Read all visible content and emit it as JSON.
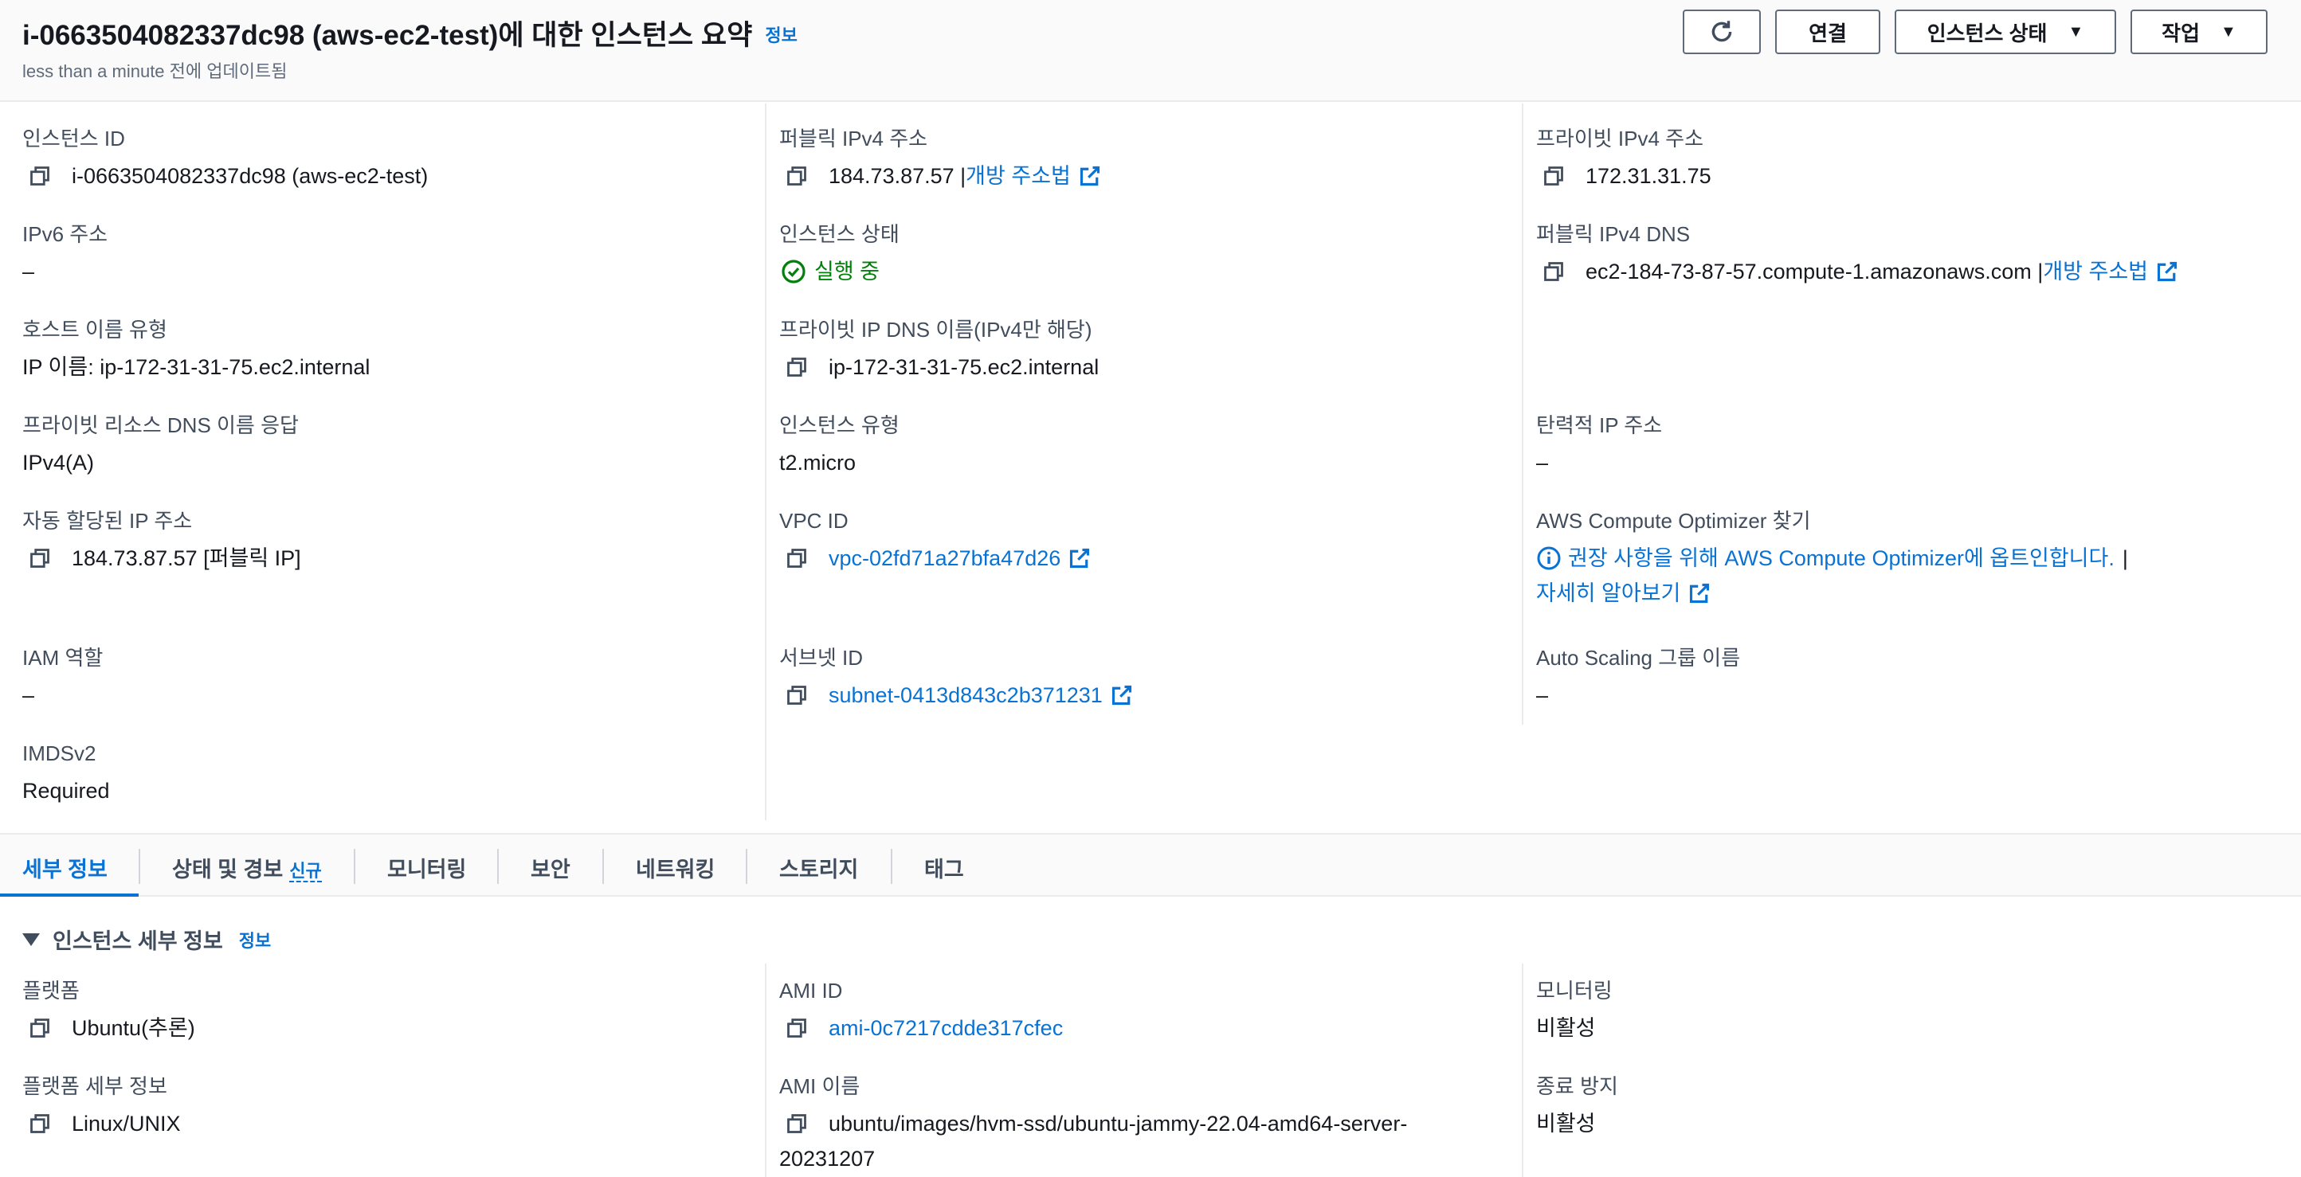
{
  "header": {
    "title": "i-0663504082337dc98 (aws-ec2-test)에 대한 인스턴스 요약",
    "info": "정보",
    "subtitle": "less than a minute 전에 업데이트됨",
    "buttons": {
      "connect": "연결",
      "instance_state": "인스턴스 상태",
      "actions": "작업"
    }
  },
  "summary": {
    "col1": [
      {
        "label": "인스턴스 ID",
        "value": "i-0663504082337dc98 (aws-ec2-test)"
      },
      {
        "label": "IPv6 주소",
        "value": "–"
      },
      {
        "label": "호스트 이름 유형",
        "value": "IP 이름: ip-172-31-31-75.ec2.internal"
      },
      {
        "label": "프라이빗 리소스 DNS 이름 응답",
        "value": "IPv4(A)"
      },
      {
        "label": "자동 할당된 IP 주소",
        "value": "184.73.87.57 [퍼블릭 IP]"
      },
      {
        "label": "IAM 역할",
        "value": "–"
      },
      {
        "label": "IMDSv2",
        "value": "Required"
      }
    ],
    "col2": [
      {
        "label": "퍼블릭 IPv4 주소",
        "value": "184.73.87.57 |",
        "link": "개방 주소법"
      },
      {
        "label": "인스턴스 상태",
        "value": "실행 중"
      },
      {
        "label": "프라이빗 IP DNS 이름(IPv4만 해당)",
        "value": "ip-172-31-31-75.ec2.internal"
      },
      {
        "label": "인스턴스 유형",
        "value": "t2.micro"
      },
      {
        "label": "VPC ID",
        "value": "vpc-02fd71a27bfa47d26"
      },
      {
        "label": "서브넷 ID",
        "value": "subnet-0413d843c2b371231"
      }
    ],
    "col3": [
      {
        "label": "프라이빗 IPv4 주소",
        "value": "172.31.31.75"
      },
      {
        "label": "퍼블릭 IPv4 DNS",
        "value": "ec2-184-73-87-57.compute-1.amazonaws.com |",
        "link": "개방 주소법"
      },
      {
        "label": "탄력적 IP 주소",
        "value": "–"
      },
      {
        "label": "AWS Compute Optimizer 찾기",
        "value": "권장 사항을 위해 AWS Compute Optimizer에 옵트인합니다.",
        "sep": "|",
        "link": "자세히 알아보기"
      },
      {
        "label": "Auto Scaling 그룹 이름",
        "value": "–"
      }
    ]
  },
  "tabs": [
    {
      "label": "세부 정보",
      "active": true
    },
    {
      "label": "상태 및 경보",
      "badge": "신규"
    },
    {
      "label": "모니터링"
    },
    {
      "label": "보안"
    },
    {
      "label": "네트워킹"
    },
    {
      "label": "스토리지"
    },
    {
      "label": "태그"
    }
  ],
  "details": {
    "section_title": "인스턴스 세부 정보",
    "info": "정보",
    "col1": [
      {
        "label": "플랫폼",
        "value": "Ubuntu(추론)"
      },
      {
        "label": "플랫폼 세부 정보",
        "value": "Linux/UNIX"
      }
    ],
    "col2": [
      {
        "label": "AMI ID",
        "value": "ami-0c7217cdde317cfec"
      },
      {
        "label": "AMI 이름",
        "value": "ubuntu/images/hvm-ssd/ubuntu-jammy-22.04-amd64-server-",
        "value2": "20231207"
      }
    ],
    "col3": [
      {
        "label": "모니터링",
        "value": "비활성"
      },
      {
        "label": "종료 방지",
        "value": "비활성"
      }
    ]
  },
  "colors": {
    "link": "#0972d3",
    "success": "#037f0c",
    "text": "#16191f",
    "label": "#414d5c"
  }
}
